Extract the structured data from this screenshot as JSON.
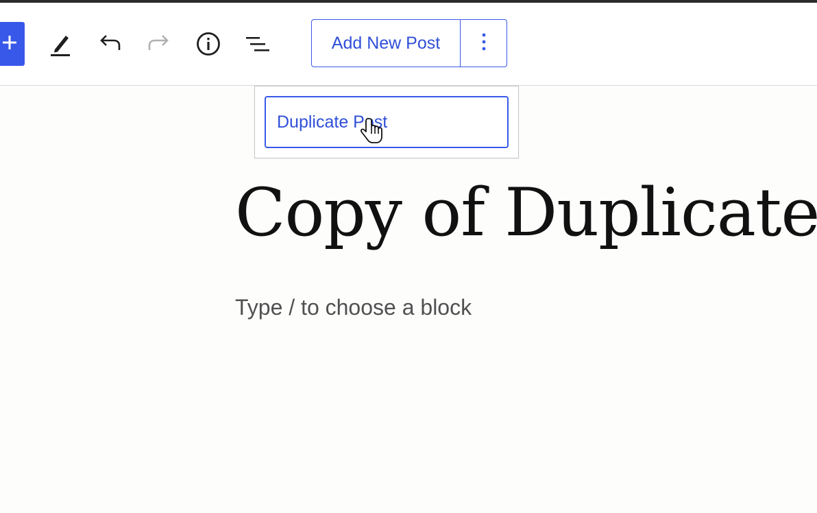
{
  "toolbar": {
    "add_new_post_label": "Add New Post",
    "icons": {
      "inserter": "plus-icon",
      "tools": "pencil-icon",
      "undo": "undo-icon",
      "redo": "redo-icon",
      "details": "info-icon",
      "list_view": "list-view-icon",
      "more": "more-vertical-icon"
    }
  },
  "dropdown": {
    "items": [
      {
        "label": "Duplicate Post"
      }
    ]
  },
  "editor": {
    "post_title": "Copy of Duplicate New",
    "block_placeholder": "Type / to choose a block"
  },
  "colors": {
    "accent": "#3858e9",
    "accent_text": "#2f4fd8",
    "redo_disabled": "#b0b0b0"
  }
}
